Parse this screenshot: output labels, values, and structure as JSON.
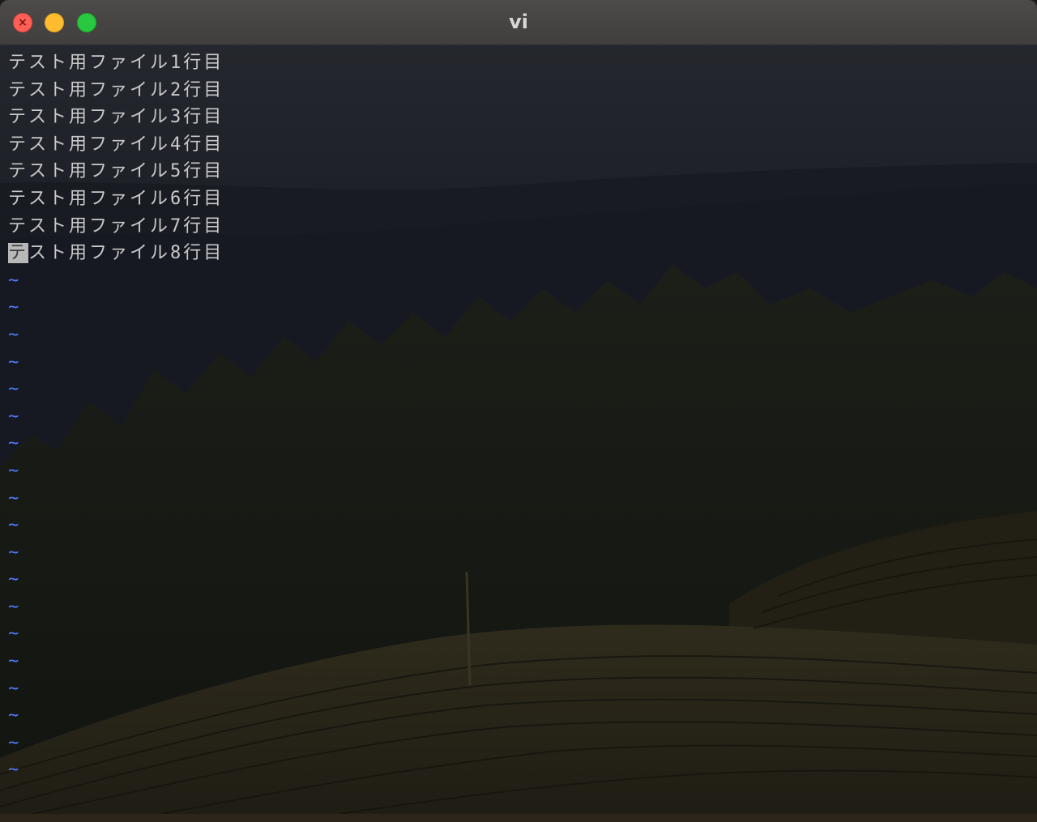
{
  "window": {
    "title": "vi"
  },
  "editor": {
    "lines": [
      "テスト用ファイル1行目",
      "テスト用ファイル2行目",
      "テスト用ファイル3行目",
      "テスト用ファイル4行目",
      "テスト用ファイル5行目",
      "テスト用ファイル6行目",
      "テスト用ファイル7行目"
    ],
    "cursor_line": {
      "cursor_char": "テ",
      "rest": "スト用ファイル8行目"
    },
    "tilde": "~",
    "tilde_count": 19
  },
  "colors": {
    "text": "#c9c9c9",
    "tilde": "#4d7bff",
    "cursor": "#b8b8b8",
    "close": "#ff5f57",
    "minimize": "#febc2e",
    "maximize": "#28c840"
  },
  "icons": {
    "close": "close-icon",
    "minimize": "minimize-icon",
    "maximize": "maximize-icon"
  }
}
